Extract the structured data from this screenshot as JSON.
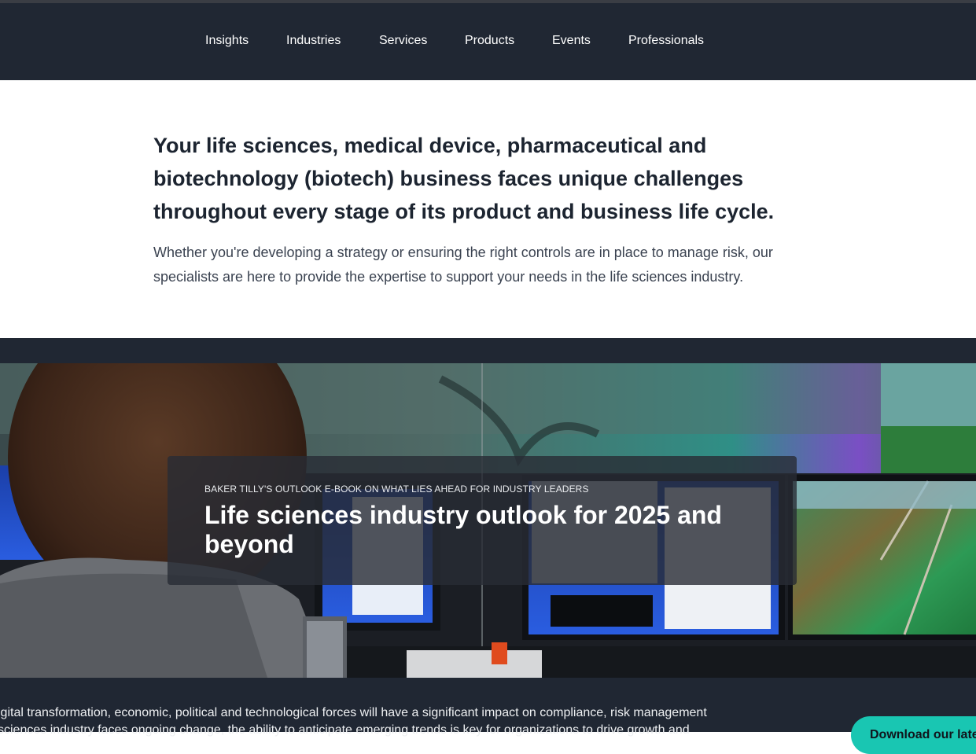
{
  "nav": {
    "items": [
      {
        "label": "Insights"
      },
      {
        "label": "Industries"
      },
      {
        "label": "Services"
      },
      {
        "label": "Products"
      },
      {
        "label": "Events"
      },
      {
        "label": "Professionals"
      }
    ]
  },
  "intro": {
    "headline": "Your life sciences, medical device, pharmaceutical and biotechnology (biotech) business faces unique challenges throughout every stage of its product and business life cycle.",
    "paragraph": "Whether you're developing a strategy or ensuring the right controls are in place to manage risk, our specialists are here to provide the expertise to support your needs in the life sciences industry."
  },
  "feature": {
    "eyebrow": "BAKER TILLY'S OUTLOOK E-BOOK ON WHAT LIES AHEAD FOR INDUSTRY LEADERS",
    "title": "Life sciences industry outlook for 2025 and beyond",
    "body_line_1": "igital transformation, economic, political and technological forces will have a significant impact on compliance, risk management",
    "body_line_2": "sciences industry faces ongoing change, the ability to anticipate emerging trends is key for organizations to drive growth and",
    "cta_label": "Download our latest e-book"
  },
  "colors": {
    "nav_background": "#202733",
    "accent": "#19c6b2"
  }
}
